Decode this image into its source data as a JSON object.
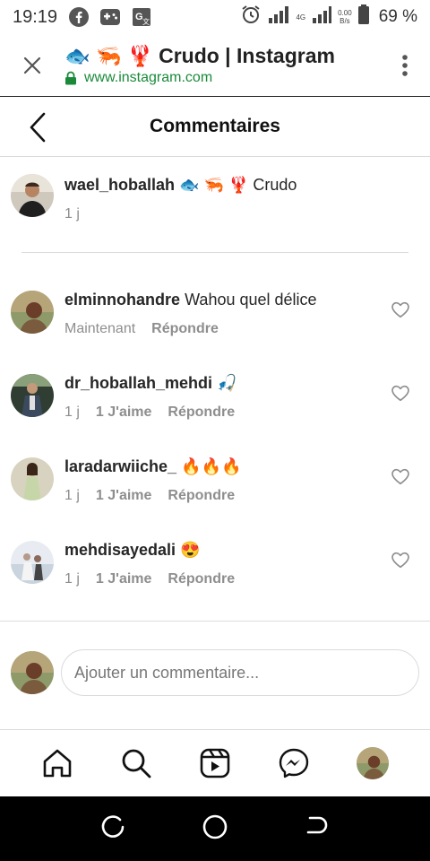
{
  "status_bar": {
    "time": "19:19",
    "network": "4G",
    "speed_top": "0.00",
    "speed_bottom": "B/s",
    "battery": "69 %",
    "icons": [
      "facebook-icon",
      "gamepad-icon",
      "translate-icon",
      "alarm-icon",
      "signal-icon",
      "battery-icon"
    ]
  },
  "browser": {
    "page_title": "🐟 🦐 🦞 Crudo | Instagram",
    "url": "www.instagram.com"
  },
  "header": {
    "title": "Commentaires"
  },
  "caption": {
    "username": "wael_hoballah",
    "text": "🐟 🦐 🦞 Crudo",
    "time": "1 j"
  },
  "comments": [
    {
      "username": "elminnohandre",
      "text": "Wahou quel délice",
      "time": "Maintenant",
      "likes": "",
      "reply": "Répondre"
    },
    {
      "username": "dr_hoballah_mehdi",
      "text": "🎣",
      "time": "1 j",
      "likes": "1 J'aime",
      "reply": "Répondre"
    },
    {
      "username": "laradarwiiche_",
      "text": "🔥🔥🔥",
      "time": "1 j",
      "likes": "1 J'aime",
      "reply": "Répondre"
    },
    {
      "username": "mehdisayedali",
      "text": "😍",
      "time": "1 j",
      "likes": "1 J'aime",
      "reply": "Répondre"
    }
  ],
  "add_comment": {
    "placeholder": "Ajouter un commentaire..."
  },
  "colors": {
    "text": "#262626",
    "meta": "#8e8e8e",
    "divider": "#dbdbdb",
    "url_green": "#1a8a3a"
  }
}
